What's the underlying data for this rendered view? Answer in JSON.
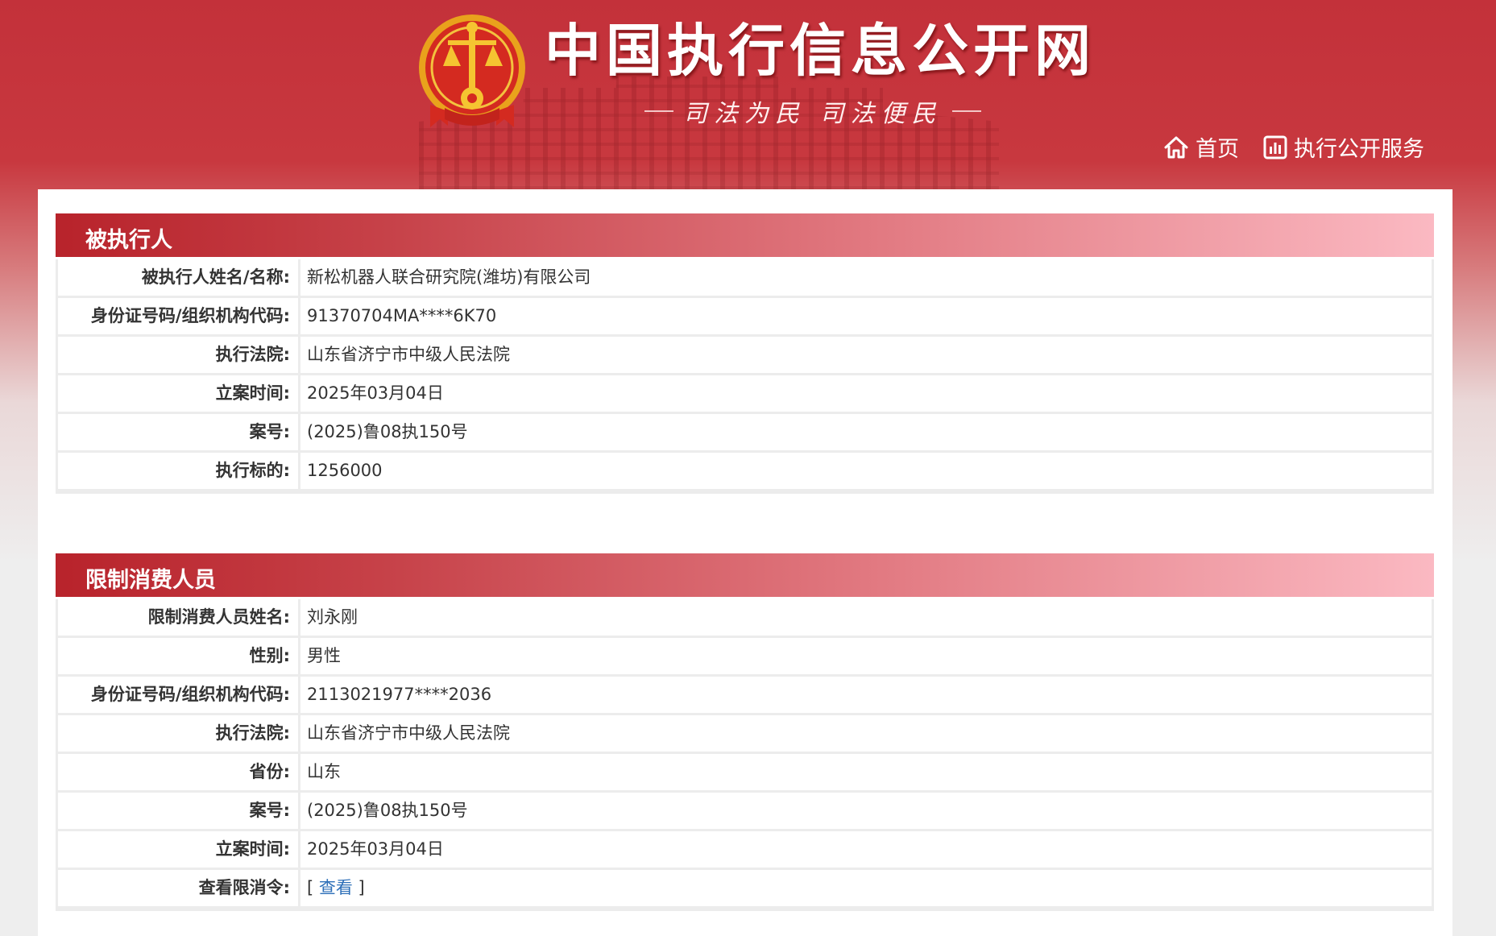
{
  "header": {
    "site_title": "中国执行信息公开网",
    "slogan": "司法为民  司法便民",
    "nav": [
      {
        "label": "首页",
        "icon": "home-icon"
      },
      {
        "label": "执行公开服务",
        "icon": "chart-icon"
      }
    ]
  },
  "colors": {
    "brand_red": "#c3313a",
    "header_gradient_start": "#b8232b",
    "header_gradient_end": "#fbb9c2",
    "link_blue": "#2d6fb8"
  },
  "sections": [
    {
      "title": "被执行人",
      "rows": [
        {
          "label": "被执行人姓名/名称:",
          "value": "新松机器人联合研究院(潍坊)有限公司"
        },
        {
          "label": "身份证号码/组织机构代码:",
          "value": "91370704MA****6K70"
        },
        {
          "label": "执行法院:",
          "value": "山东省济宁市中级人民法院"
        },
        {
          "label": "立案时间:",
          "value": "2025年03月04日"
        },
        {
          "label": "案号:",
          "value": "(2025)鲁08执150号"
        },
        {
          "label": "执行标的:",
          "value": "1256000"
        }
      ]
    },
    {
      "title": "限制消费人员",
      "rows": [
        {
          "label": "限制消费人员姓名:",
          "value": "刘永刚"
        },
        {
          "label": "性别:",
          "value": "男性"
        },
        {
          "label": "身份证号码/组织机构代码:",
          "value": "2113021977****2036"
        },
        {
          "label": "执行法院:",
          "value": "山东省济宁市中级人民法院"
        },
        {
          "label": "省份:",
          "value": "山东"
        },
        {
          "label": "案号:",
          "value": "(2025)鲁08执150号"
        },
        {
          "label": "立案时间:",
          "value": "2025年03月04日"
        },
        {
          "label": "查看限消令:",
          "value_prefix": "[ ",
          "link_text": "查看",
          "value_suffix": " ]"
        }
      ]
    }
  ]
}
